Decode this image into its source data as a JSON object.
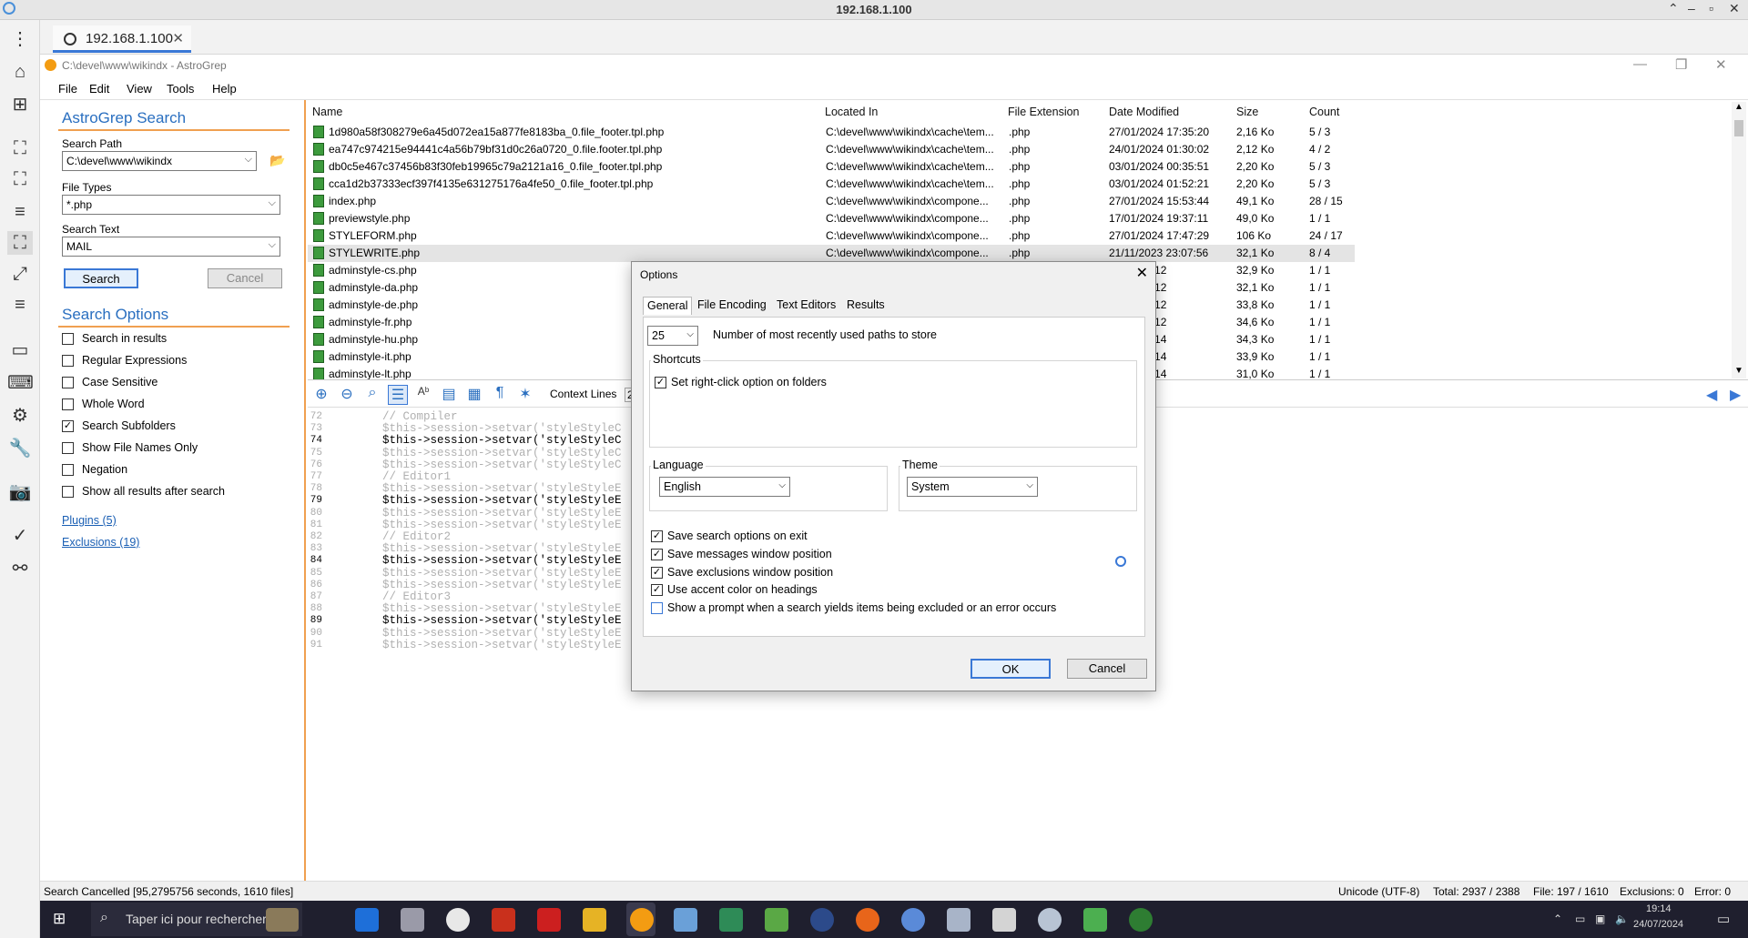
{
  "remote_title": "192.168.1.100",
  "tab": {
    "label": "192.168.1.100"
  },
  "app": {
    "title": "C:\\devel\\www\\wikindx - AstroGrep"
  },
  "menu": [
    "File",
    "Edit",
    "View",
    "Tools",
    "Help"
  ],
  "search_panel": {
    "heading": "AstroGrep Search",
    "search_path_label": "Search Path",
    "search_path_value": "C:\\devel\\www\\wikindx",
    "file_types_label": "File Types",
    "file_types_value": "*.php",
    "search_text_label": "Search Text",
    "search_text_value": "MAIL",
    "search_button": "Search",
    "cancel_button": "Cancel"
  },
  "search_options": {
    "heading": "Search Options",
    "items": [
      {
        "label": "Search in results",
        "checked": false
      },
      {
        "label": "Regular Expressions",
        "checked": false
      },
      {
        "label": "Case Sensitive",
        "checked": false
      },
      {
        "label": "Whole Word",
        "checked": false
      },
      {
        "label": "Search Subfolders",
        "checked": true
      },
      {
        "label": "Show File Names Only",
        "checked": false
      },
      {
        "label": "Negation",
        "checked": false
      },
      {
        "label": "Show all results after search",
        "checked": false
      }
    ],
    "plugins_link": "Plugins (5)",
    "exclusions_link": "Exclusions (19)"
  },
  "results": {
    "columns": [
      "Name",
      "Located In",
      "File Extension",
      "Date Modified",
      "Size",
      "Count"
    ],
    "rows": [
      [
        "1d980a58f308279e6a45d072ea15a877fe8183ba_0.file_footer.tpl.php",
        "C:\\devel\\www\\wikindx\\cache\\tem...",
        ".php",
        "27/01/2024 17:35:20",
        "2,16 Ko",
        "5 / 3"
      ],
      [
        "ea747c974215e94441c4a56b79bf31d0c26a0720_0.file.footer.tpl.php",
        "C:\\devel\\www\\wikindx\\cache\\tem...",
        ".php",
        "24/01/2024 01:30:02",
        "2,12 Ko",
        "4 / 2"
      ],
      [
        "db0c5e467c37456b83f30feb19965c79a2121a16_0.file_footer.tpl.php",
        "C:\\devel\\www\\wikindx\\cache\\tem...",
        ".php",
        "03/01/2024 00:35:51",
        "2,20 Ko",
        "5 / 3"
      ],
      [
        "cca1d2b37333ecf397f4135e631275176a4fe50_0.file_footer.tpl.php",
        "C:\\devel\\www\\wikindx\\cache\\tem...",
        ".php",
        "03/01/2024 01:52:21",
        "2,20 Ko",
        "5 / 3"
      ],
      [
        "index.php",
        "C:\\devel\\www\\wikindx\\compone...",
        ".php",
        "27/01/2024 15:53:44",
        "49,1 Ko",
        "28 / 15"
      ],
      [
        "previewstyle.php",
        "C:\\devel\\www\\wikindx\\compone...",
        ".php",
        "17/01/2024 19:37:11",
        "49,0 Ko",
        "1 / 1"
      ],
      [
        "STYLEFORM.php",
        "C:\\devel\\www\\wikindx\\compone...",
        ".php",
        "27/01/2024 17:47:29",
        "106 Ko",
        "24 / 17"
      ],
      [
        "STYLEWRITE.php",
        "C:\\devel\\www\\wikindx\\compone...",
        ".php",
        "21/11/2023 23:07:56",
        "32,1 Ko",
        "8 / 4"
      ],
      [
        "adminstyle-cs.php",
        "",
        "",
        "24 22:02:12",
        "32,9 Ko",
        "1 / 1"
      ],
      [
        "adminstyle-da.php",
        "",
        "",
        "24 22:02:12",
        "32,1 Ko",
        "1 / 1"
      ],
      [
        "adminstyle-de.php",
        "",
        "",
        "24 22:02:12",
        "33,8 Ko",
        "1 / 1"
      ],
      [
        "adminstyle-fr.php",
        "",
        "",
        "24 22:02:12",
        "34,6 Ko",
        "1 / 1"
      ],
      [
        "adminstyle-hu.php",
        "",
        "",
        "24 22:02:14",
        "34,3 Ko",
        "1 / 1"
      ],
      [
        "adminstyle-it.php",
        "",
        "",
        "24 22:02:14",
        "33,9 Ko",
        "1 / 1"
      ],
      [
        "adminstyle-lt.php",
        "",
        "",
        "24 22:02:14",
        "31,0 Ko",
        "1 / 1"
      ]
    ],
    "selected_row": 7
  },
  "editor_toolbar": {
    "context_lines_label": "Context Lines",
    "context_lines_value": "2"
  },
  "code_lines": [
    {
      "n": "72",
      "t": "// Compiler",
      "hit": false
    },
    {
      "n": "73",
      "t": "$this->session->setvar('styleStyleC",
      "hit": false
    },
    {
      "n": "74",
      "t": "$this->session->setvar('styleStyleC",
      "hit": true
    },
    {
      "n": "75",
      "t": "$this->session->setvar('styleStyleC",
      "hit": false
    },
    {
      "n": "76",
      "t": "$this->session->setvar('styleStyleC",
      "hit": false
    },
    {
      "n": "77",
      "t": "// Editor1",
      "hit": false
    },
    {
      "n": "78",
      "t": "$this->session->setvar('styleStyleE",
      "hit": false
    },
    {
      "n": "79",
      "t": "$this->session->setvar('styleStyleE",
      "hit": true
    },
    {
      "n": "80",
      "t": "$this->session->setvar('styleStyleE",
      "hit": false
    },
    {
      "n": "81",
      "t": "$this->session->setvar('styleStyleE",
      "hit": false
    },
    {
      "n": "82",
      "t": "// Editor2",
      "hit": false
    },
    {
      "n": "83",
      "t": "$this->session->setvar('styleStyleE",
      "hit": false
    },
    {
      "n": "84",
      "t": "$this->session->setvar('styleStyleE",
      "hit": true
    },
    {
      "n": "85",
      "t": "$this->session->setvar('styleStyleE",
      "hit": false
    },
    {
      "n": "86",
      "t": "$this->session->setvar('styleStyleE",
      "hit": false
    },
    {
      "n": "87",
      "t": "// Editor3",
      "hit": false
    },
    {
      "n": "88",
      "t": "$this->session->setvar('styleStyleE",
      "hit": false
    },
    {
      "n": "89",
      "t": "$this->session->setvar('styleStyleE",
      "hit": true
    },
    {
      "n": "90",
      "t": "$this->session->setvar('styleStyleE",
      "hit": false
    },
    {
      "n": "91",
      "t": "$this->session->setvar('styleStyleE",
      "hit": false
    }
  ],
  "options_dialog": {
    "title": "Options",
    "tabs": [
      "General",
      "File Encoding",
      "Text Editors",
      "Results"
    ],
    "active_tab": "General",
    "mru_value": "25",
    "mru_label": "Number of most recently used paths to store",
    "shortcuts_title": "Shortcuts",
    "shortcut_right_click": "Set right-click option on folders",
    "language_title": "Language",
    "language_value": "English",
    "theme_title": "Theme",
    "theme_value": "System",
    "checks": [
      {
        "label": "Save search options on exit",
        "checked": true
      },
      {
        "label": "Save messages window position",
        "checked": true
      },
      {
        "label": "Save exclusions window position",
        "checked": true
      },
      {
        "label": "Use accent color on headings",
        "checked": true
      },
      {
        "label": "Show a prompt when a search yields items being excluded or an error occurs",
        "checked": false
      }
    ],
    "ok_button": "OK",
    "cancel_button": "Cancel"
  },
  "status": {
    "message": "Search Cancelled [95,2795756 seconds, 1610 files]",
    "encoding": "Unicode (UTF-8)",
    "total": "Total: 2937 / 2388",
    "file": "File: 197 / 1610",
    "exclusions": "Exclusions: 0",
    "error": "Error: 0"
  },
  "taskbar": {
    "search_placeholder": "Taper ici pour rechercher",
    "time": "19:14",
    "date": "24/07/2024"
  },
  "colors": {
    "accent": "#2a6fc0",
    "heading_line": "#f0a050",
    "selection": "#e4e4e4"
  }
}
